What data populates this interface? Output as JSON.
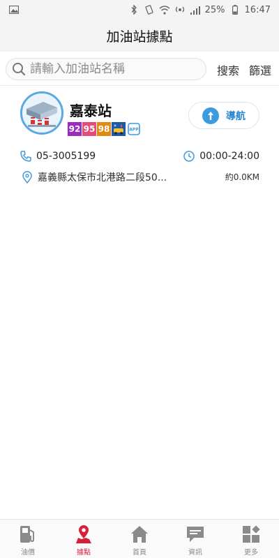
{
  "status_bar": {
    "battery": "25%",
    "time": "16:47",
    "icons": [
      "image-icon",
      "bluetooth-icon",
      "vibrate-icon",
      "wifi-icon",
      "hotspot-icon",
      "signal-icon",
      "battery-icon"
    ]
  },
  "header": {
    "title": "加油站據點"
  },
  "search": {
    "placeholder": "請輸入加油站名稱",
    "value": "",
    "search_label": "搜索",
    "filter_label": "篩選"
  },
  "station": {
    "name": "嘉泰站",
    "fuels": [
      {
        "label": "92",
        "color": "#9b2bc1"
      },
      {
        "label": "95",
        "color": "#e34b7a"
      },
      {
        "label": "98",
        "color": "#e08a12"
      }
    ],
    "service_icons": [
      "carwash-icon",
      "app-pay-icon"
    ],
    "navigate_label": "導航",
    "phone": "05-3005199",
    "hours": "00:00-24:00",
    "address": "嘉義縣太保市北港路二段50...",
    "distance": "約0.0KM"
  },
  "colors": {
    "accent_blue": "#3d9be0",
    "active_red": "#d6203a",
    "inactive_gray": "#8a8a8a"
  },
  "bottom_nav": {
    "tabs": [
      {
        "label": "油價",
        "icon": "fuel-pump-icon",
        "active": false
      },
      {
        "label": "據點",
        "icon": "map-pin-icon",
        "active": true
      },
      {
        "label": "首頁",
        "icon": "home-icon",
        "active": false
      },
      {
        "label": "資訊",
        "icon": "message-icon",
        "active": false
      },
      {
        "label": "更多",
        "icon": "grid-more-icon",
        "active": false
      }
    ]
  }
}
